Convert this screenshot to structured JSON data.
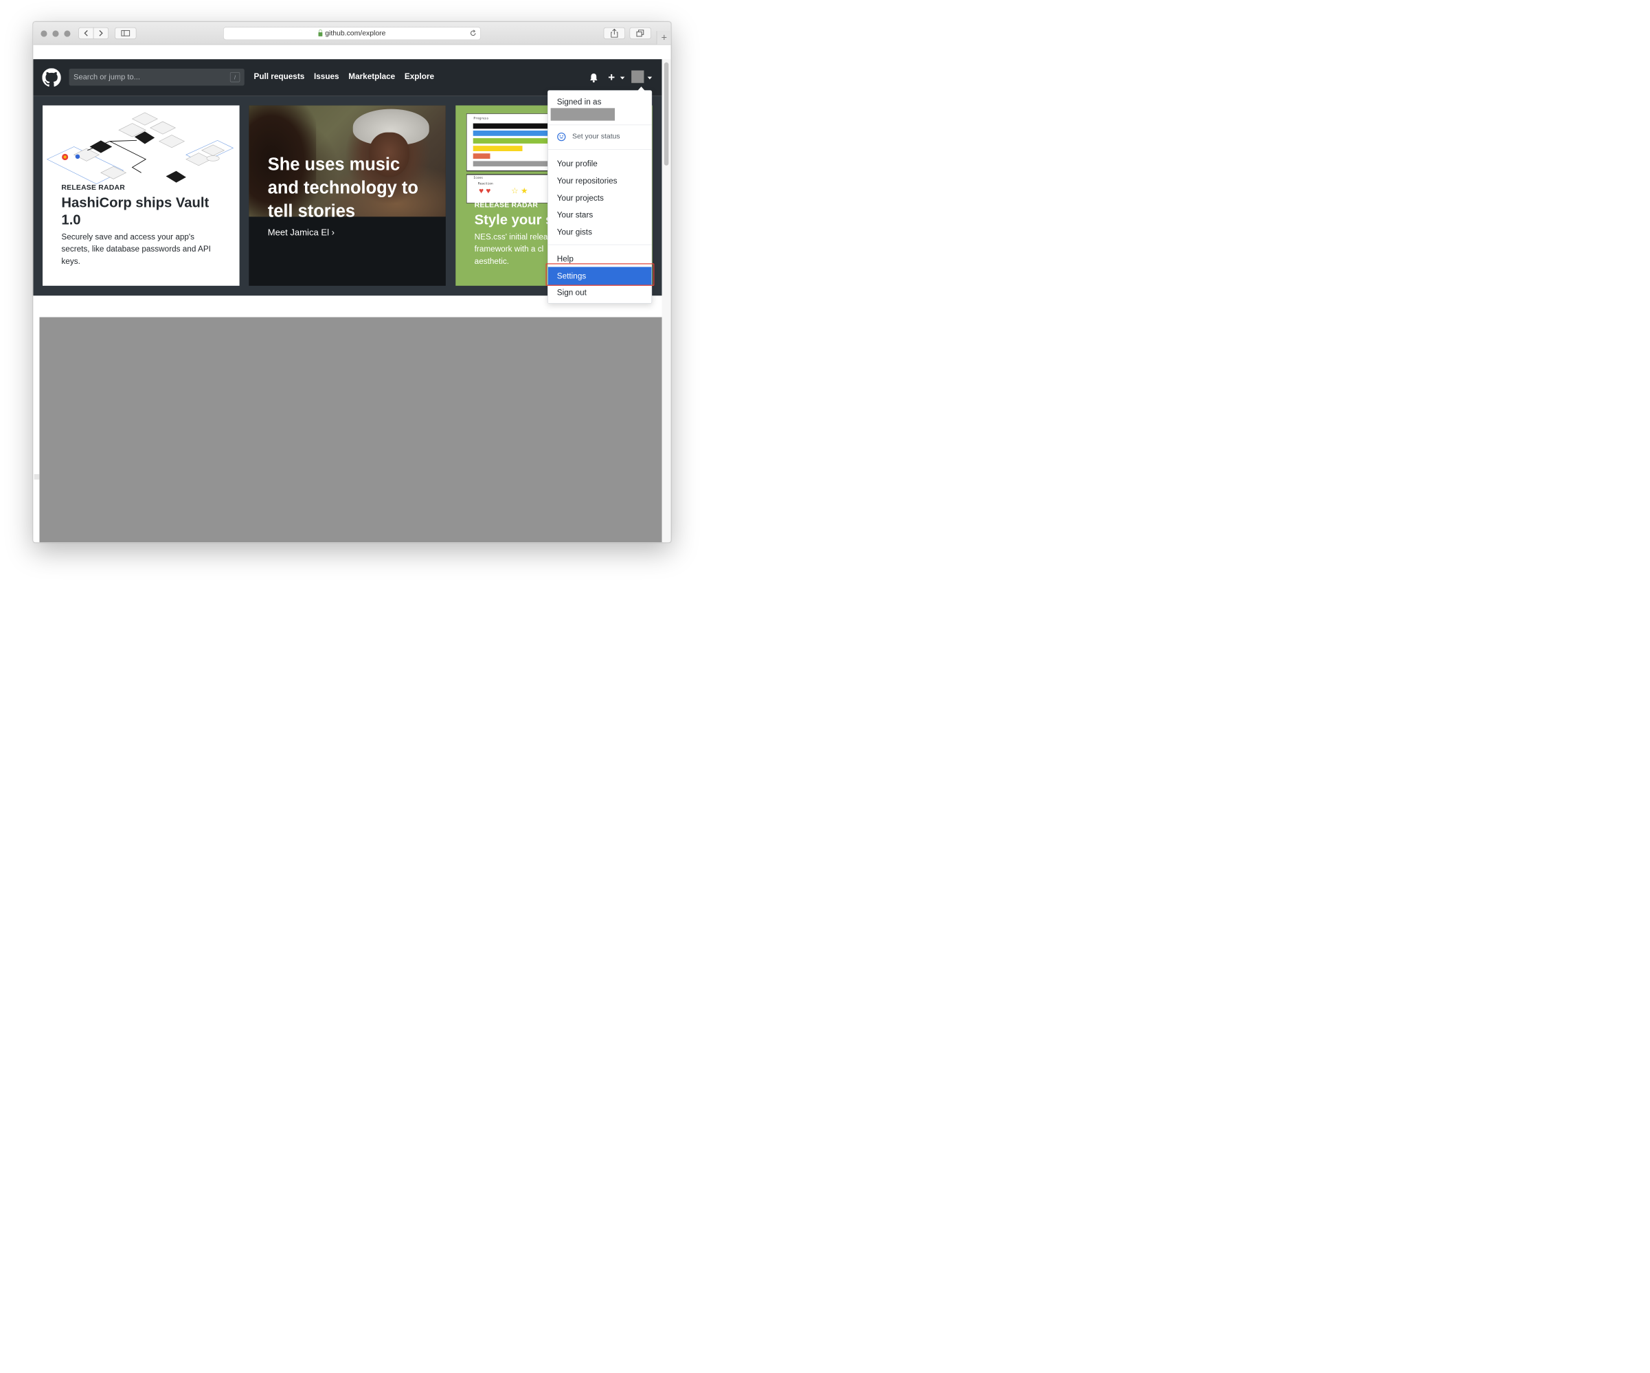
{
  "browser": {
    "url": "github.com/explore"
  },
  "header": {
    "search_placeholder": "Search or jump to...",
    "slash_hint": "/",
    "nav": [
      "Pull requests",
      "Issues",
      "Marketplace",
      "Explore"
    ]
  },
  "cards": [
    {
      "eyebrow": "RELEASE RADAR",
      "title_line1": "HashiCorp ships Vault",
      "title_line2": "1.0",
      "desc_line1": "Securely save and access your app's",
      "desc_line2": "secrets, like database passwords and API",
      "desc_line3": "keys."
    },
    {
      "title_line1": "She uses music",
      "title_line2": "and technology to",
      "title_line3": "tell stories",
      "link": "Meet Jamica El ›"
    },
    {
      "eyebrow": "RELEASE RADAR",
      "title": "Style your s",
      "desc_line1": "NES.css' initial relea",
      "desc_line2": "framework with a cl",
      "desc_line3": "aesthetic.",
      "nes_progress_label": "Progress",
      "nes_icons_label": "Icons",
      "nes_reaction_label": "Reaction"
    }
  ],
  "user_menu": {
    "signed_in_as": "Signed in as",
    "set_status": "Set your status",
    "profile": "Your profile",
    "repositories": "Your repositories",
    "projects": "Your projects",
    "stars": "Your stars",
    "gists": "Your gists",
    "help": "Help",
    "settings": "Settings",
    "sign_out": "Sign out"
  },
  "colors": {
    "header_bg": "#24292e",
    "hero_band": "#2f363d",
    "selected_item": "#2f6fdb",
    "highlight_border": "#e0443a",
    "nes_card": "#8db55c"
  }
}
